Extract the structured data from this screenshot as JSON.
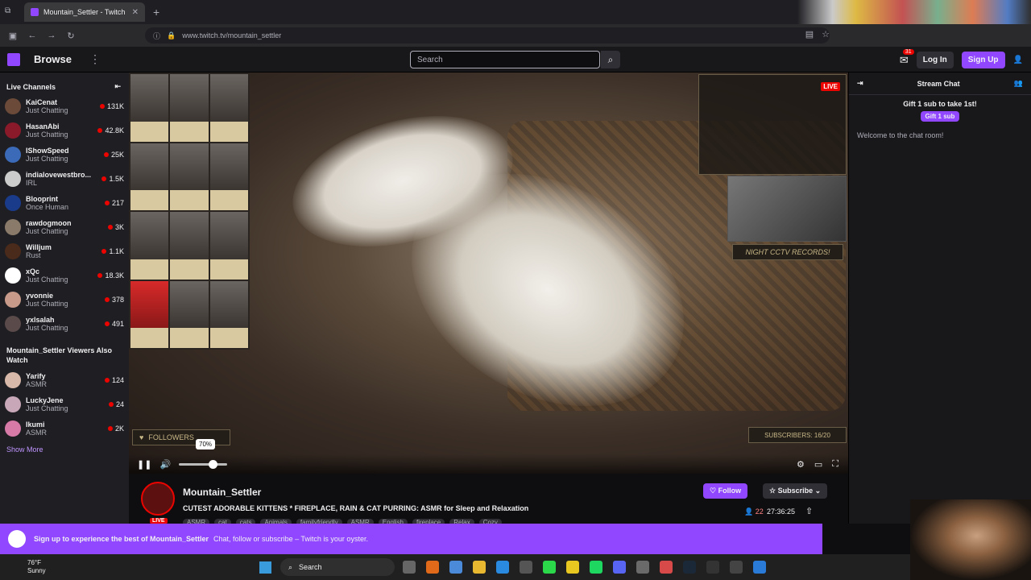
{
  "browser": {
    "tab_title": "Mountain_Settler - Twitch",
    "url": "www.twitch.tv/mountain_settler"
  },
  "topnav": {
    "browse": "Browse",
    "search_placeholder": "Search",
    "notifications_count": "31",
    "login": "Log In",
    "signup": "Sign Up"
  },
  "sidebar": {
    "live_heading": "Live Channels",
    "channels": [
      {
        "name": "KaiCenat",
        "category": "Just Chatting",
        "viewers": "131K",
        "color": "#6b4a3a"
      },
      {
        "name": "HasanAbi",
        "category": "Just Chatting",
        "viewers": "42.8K",
        "color": "#8a1a2a"
      },
      {
        "name": "IShowSpeed",
        "category": "Just Chatting",
        "viewers": "25K",
        "color": "#3a6ab8"
      },
      {
        "name": "indialovewestbro...",
        "category": "IRL",
        "viewers": "1.5K",
        "color": "#cccccc"
      },
      {
        "name": "Blooprint",
        "category": "Once Human",
        "viewers": "217",
        "color": "#1a3a8a"
      },
      {
        "name": "rawdogmoon",
        "category": "Just Chatting",
        "viewers": "3K",
        "color": "#8a7a6a"
      },
      {
        "name": "Willjum",
        "category": "Rust",
        "viewers": "1.1K",
        "color": "#4a2a1a"
      },
      {
        "name": "xQc",
        "category": "Just Chatting",
        "viewers": "18.3K",
        "color": "#ffffff"
      },
      {
        "name": "yvonnie",
        "category": "Just Chatting",
        "viewers": "378",
        "color": "#c89a8a"
      },
      {
        "name": "yxlsalah",
        "category": "Just Chatting",
        "viewers": "491",
        "color": "#5a4a4a"
      }
    ],
    "also_heading": "Mountain_Settler Viewers Also Watch",
    "also": [
      {
        "name": "Yarify",
        "category": "ASMR",
        "viewers": "124",
        "color": "#d8b8a8"
      },
      {
        "name": "LuckyJene",
        "category": "Just Chatting",
        "viewers": "24",
        "color": "#c8a8b8"
      },
      {
        "name": "Ikumi",
        "category": "ASMR",
        "viewers": "2K",
        "color": "#d87aa8"
      }
    ],
    "show_more": "Show More"
  },
  "player": {
    "live_badge": "LIVE",
    "cctv_label": "NIGHT CCTV RECORDS!",
    "subscribers": "SUBSCRIBERS: 16/20",
    "followers": "FOLLOWERS",
    "volume_tip": "70%",
    "volume_level": 0.7
  },
  "stream": {
    "channel": "Mountain_Settler",
    "live": "LIVE",
    "title": "CUTEST ADORABLE KITTENS * FIREPLACE, RAIN & CAT PURRING: ASMR for Sleep and Relaxation",
    "tags": [
      "ASMR",
      "cat",
      "cats",
      "Animals",
      "familyfriendly",
      "ASMR",
      "English",
      "fireplace",
      "Relax",
      "Cozy"
    ],
    "follow": "Follow",
    "subscribe": "Subscribe",
    "viewers": "22",
    "uptime": "27:36:25"
  },
  "chat": {
    "title": "Stream Chat",
    "gift_text": "Gift 1 sub to take 1st!",
    "gift_button": "Gift 1 sub",
    "welcome": "Welcome to the chat room!"
  },
  "banner": {
    "bold": "Sign up to experience the best of Mountain_Settler",
    "text": "Chat, follow or subscribe – Twitch is your oyster."
  },
  "taskbar": {
    "temp": "76°F",
    "weather": "Sunny",
    "search": "Search"
  }
}
